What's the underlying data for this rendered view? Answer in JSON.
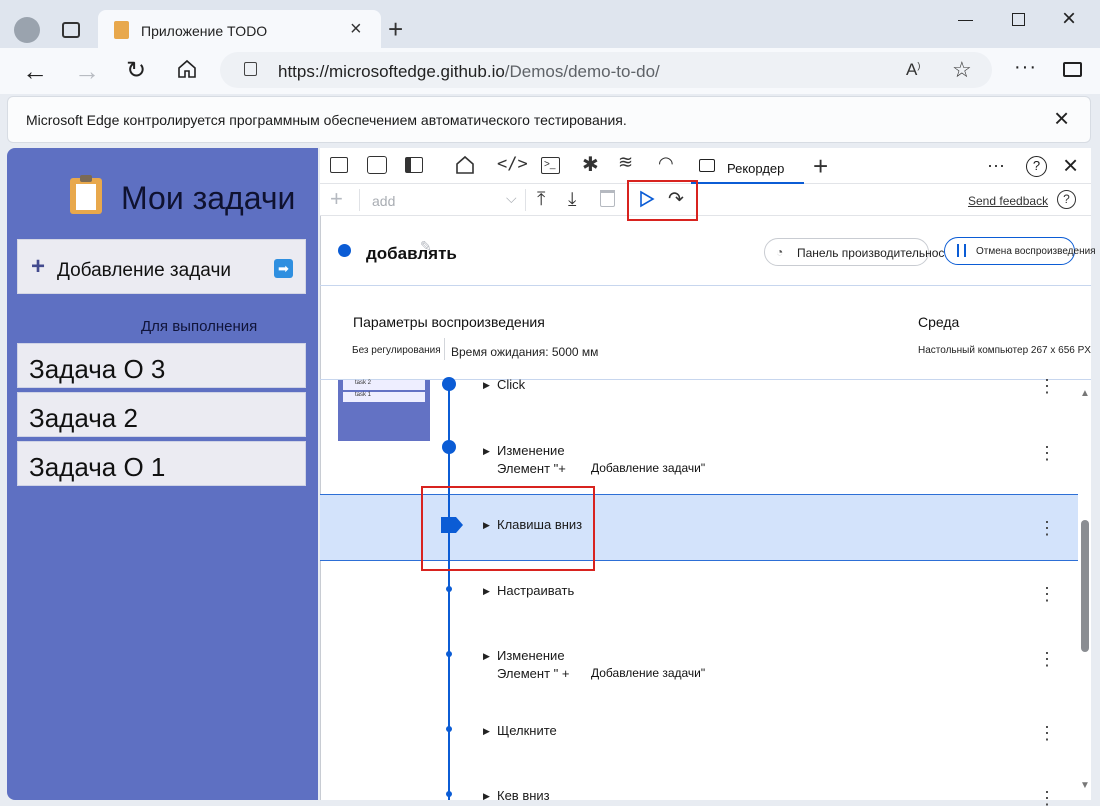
{
  "browser": {
    "tab_title": "Приложение TODO",
    "url_base": "https://microsoftedge.github.io",
    "url_path": "/Demos/demo-to-do/",
    "automation_notice": "Microsoft Edge контролируется программным обеспечением автоматического тестирования."
  },
  "app": {
    "title": "Мои задачи",
    "add_task_label": "Добавление задачи",
    "section_label": "Для выполнения",
    "tasks": [
      "Задача О 3",
      "Задача 2",
      "Задача О 1"
    ]
  },
  "devtools": {
    "recorder_tab": "Рекордер",
    "recording_select_placeholder": "add",
    "send_feedback": "Send feedback",
    "recording_name": "добавлять",
    "perf_panel_button": "Панель производительности",
    "cancel_replay_button": "Отмена воспроизведения",
    "settings": {
      "playback_title": "Параметры воспроизведения",
      "throttling": "Без регулирования",
      "timeout": "Время ожидания: 5000 мм",
      "env_title": "Среда",
      "env_value": "Настольный компьютер 267 x 656 PX"
    },
    "thumbnail_rows": [
      "task 2",
      "task 1"
    ],
    "steps": [
      {
        "title": "Click",
        "detail": ""
      },
      {
        "title": "Изменение",
        "detail_prefix": "Элемент \"+",
        "detail_suffix": "Добавление задачи\""
      },
      {
        "title": "Клавиша вниз",
        "detail": ""
      },
      {
        "title": "Настраивать",
        "detail": ""
      },
      {
        "title": "Изменение",
        "detail_prefix": "Элемент \" +",
        "detail_suffix": "Добавление задачи\""
      },
      {
        "title": "Щелкните",
        "detail": ""
      },
      {
        "title": "Кев вниз",
        "detail": ""
      }
    ]
  },
  "colors": {
    "accent": "#0b5cd5",
    "highlight": "#d3e3fb",
    "red_outline": "#d8231f",
    "app_bg": "#5e70c2"
  }
}
